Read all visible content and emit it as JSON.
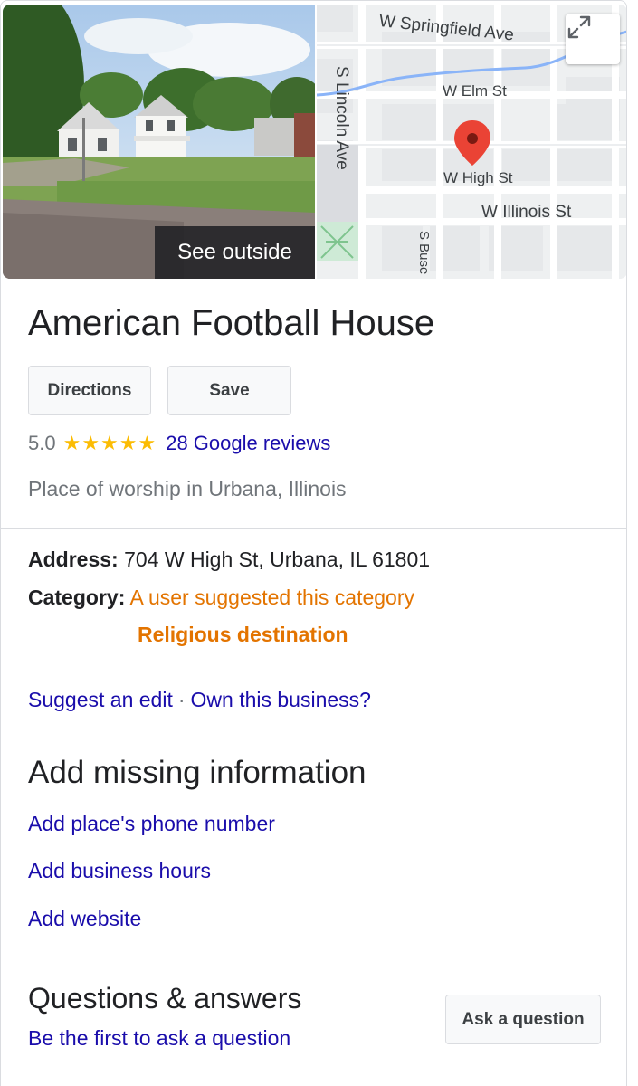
{
  "media": {
    "see_outside_label": "See outside",
    "map": {
      "streets": {
        "springfield": "W Springfield Ave",
        "elm": "W Elm St",
        "high": "W High St",
        "illinois": "W Illinois St",
        "lincoln": "S Lincoln Ave",
        "busey": "S Buse"
      },
      "pin_color": "#ea4335",
      "expand_icon": "expand-icon"
    }
  },
  "place": {
    "name": "American Football House",
    "actions": {
      "directions_label": "Directions",
      "save_label": "Save"
    },
    "rating": {
      "value": "5.0",
      "stars": "★★★★★",
      "reviews_label": "28 Google reviews"
    },
    "subtitle": "Place of worship in Urbana, Illinois"
  },
  "details": {
    "address_label": "Address:",
    "address_value": " 704 W High St, Urbana, IL 61801",
    "category_label": "Category:",
    "category_note": " A user suggested this category",
    "category_value": "Religious destination"
  },
  "edit_links": {
    "suggest_edit": "Suggest an edit",
    "separator": "·",
    "own_business": "Own this business?"
  },
  "missing_info": {
    "title": "Add missing information",
    "items": [
      "Add place's phone number",
      "Add business hours",
      "Add website"
    ]
  },
  "qa": {
    "title": "Questions & answers",
    "first_ask_label": "Be the first to ask a question",
    "ask_button_label": "Ask a question"
  },
  "colors": {
    "link": "#1a0dab",
    "star": "#fbbc04",
    "category_orange": "#e37400",
    "secondary_text": "#70757a"
  }
}
